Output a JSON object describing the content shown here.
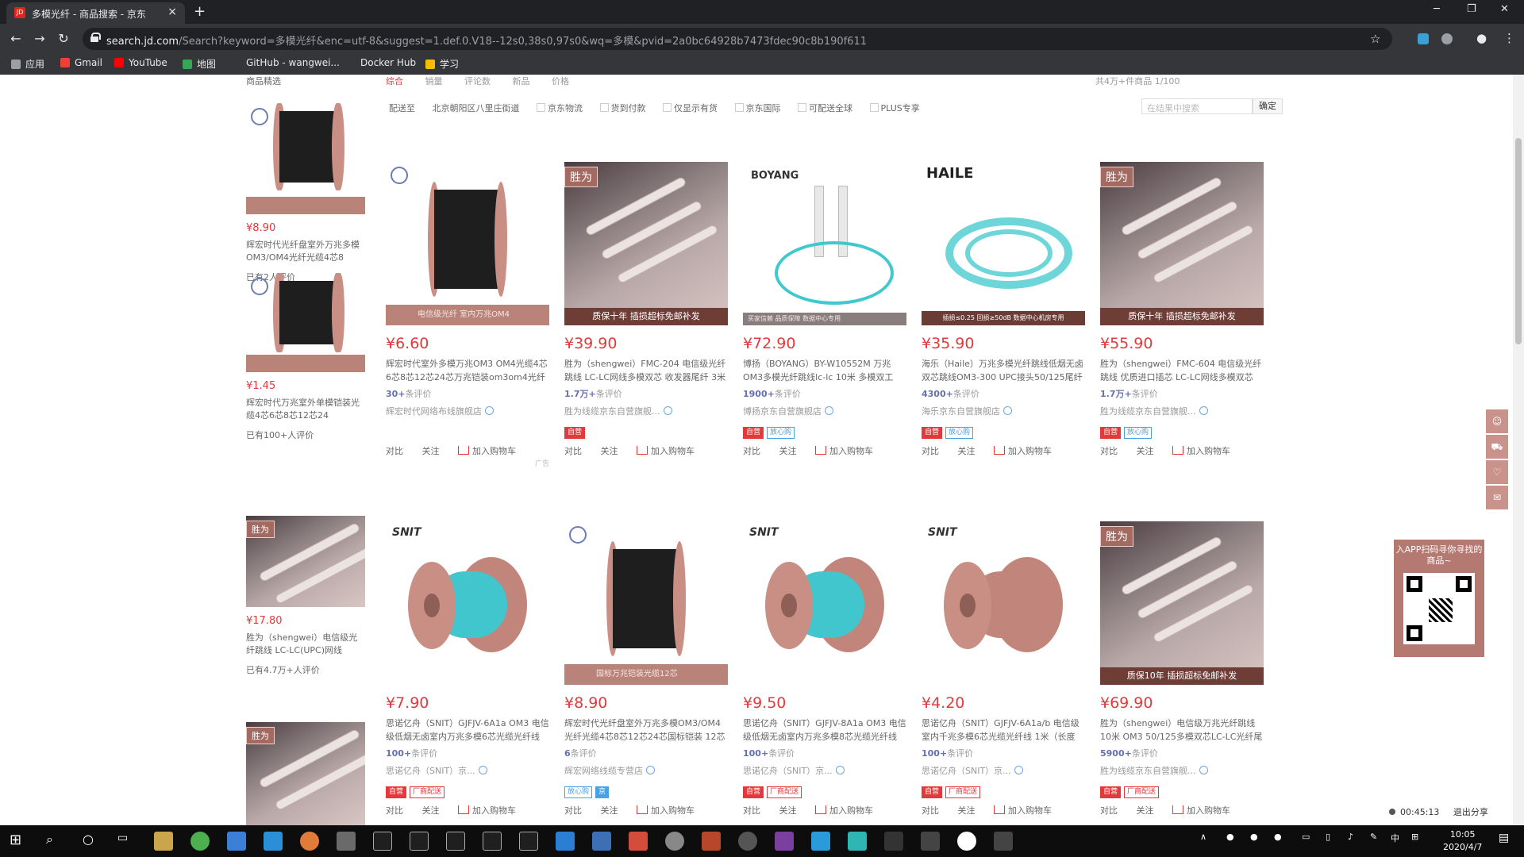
{
  "browser": {
    "tab_title": "多模光纤 - 商品搜索 - 京东",
    "tab_close": "×",
    "new_tab": "+",
    "url_host": "search.jd.com",
    "url_path": "/Search?keyword=多模光纤&enc=utf-8&suggest=1.def.0.V18--12s0,38s0,97s0&wq=多模&pvid=2a0bc64928b7473fdec90c8b190f611",
    "bookmarks": [
      "应用",
      "Gmail",
      "YouTube",
      "地图",
      "GitHub - wangwei...",
      "Docker Hub",
      "学习"
    ]
  },
  "filters": {
    "sort": [
      "综合",
      "销量",
      "评论数",
      "新品",
      "价格"
    ],
    "pager": "共4万+件商品  1/100",
    "ship_to_label": "配送至",
    "ship_to": "北京朝阳区八里庄街道",
    "options": [
      "京东物流",
      "货到付款",
      "仅显示有货",
      "京东国际",
      "可配送全球",
      "PLUS专享"
    ],
    "in_search_placeholder": "在结果中搜索",
    "confirm": "确定"
  },
  "sidebar": {
    "title": "商品精选",
    "items": [
      {
        "price": "¥8.90",
        "name": "辉宏时代光纤盘室外万兆多模OM3/OM4光纤光缆4芯8",
        "comments": "已有2人评价",
        "kind": "spool"
      },
      {
        "price": "¥1.45",
        "name": "辉宏时代万兆室外单模铠装光缆4芯6芯8芯12芯24",
        "comments": "已有100+人评价",
        "kind": "spool"
      },
      {
        "price": "¥17.80",
        "name": "胜为（shengwei）电信级光纤跳线 LC-LC(UPC)网线",
        "comments": "已有4.7万+人评价",
        "kind": "sw"
      },
      {
        "price": "",
        "name": "",
        "comments": "",
        "kind": "sw"
      }
    ]
  },
  "products": [
    {
      "price": "¥6.60",
      "name": "辉宏时代室外多模万兆OM3 OM4光缆4芯6芯8芯12芯24芯万兆铠装om3om4光纤线",
      "comments": "30+",
      "comments_suffix": "条评价",
      "shop": "辉宏时代网络布线旗舰店",
      "tags": [],
      "ad": "广告",
      "kind": "spool",
      "banner": "电信级光纤 室内万兆OM4"
    },
    {
      "price": "¥39.90",
      "name": "胜为（shengwei）FMC-204 电信级光纤跳线 LC-LC网线多模双芯 收发器尾纤 3米",
      "comments": "1.7万+",
      "comments_suffix": "条评价",
      "shop": "胜为线缆京东自营旗舰...",
      "tags": [
        "自营"
      ],
      "ad": "",
      "kind": "sw",
      "banner": "质保十年 插损超标免邮补发"
    },
    {
      "price": "¥72.90",
      "name": "博扬（BOYANG）BY-W10552M 万兆OM3多模光纤跳线lc-lc 10米 多模双工 OM3多模双",
      "comments": "1900+",
      "comments_suffix": "条评价",
      "shop": "博扬京东自营旗舰店",
      "tags": [
        "自营",
        "放心购"
      ],
      "ad": "",
      "kind": "boyang",
      "banner": "买家信赖 品质保障 数据中心专用"
    },
    {
      "price": "¥35.90",
      "name": "海乐（Haile）万兆多模光纤跳线低烟无卤双芯跳线OM3-300 UPC接头50/125尾纤",
      "comments": "4300+",
      "comments_suffix": "条评价",
      "shop": "海乐京东自营旗舰店",
      "tags": [
        "自营",
        "放心购"
      ],
      "ad": "",
      "kind": "haile",
      "banner": "插损≤0.25 回损≥50dB 数据中心机房专用"
    },
    {
      "price": "¥55.90",
      "name": "胜为（shengwei）FMC-604 电信级光纤跳线 优质进口插芯 LC-LC网线多模双芯",
      "comments": "1.7万+",
      "comments_suffix": "条评价",
      "shop": "胜为线缆京东自营旗舰...",
      "tags": [
        "自营",
        "放心购"
      ],
      "ad": "",
      "kind": "sw",
      "banner": "质保十年 插损超标免邮补发"
    },
    {
      "price": "¥7.90",
      "name": "思诺亿舟（SNIT）GJFJV-6A1a OM3 电信级低烟无卤室内万兆多模6芯光缆光纤线",
      "comments": "100+",
      "comments_suffix": "条评价",
      "shop": "思诺亿舟（SNIT）京...",
      "tags": [
        "自营",
        "厂商配送"
      ],
      "ad": "",
      "kind": "snit-blue",
      "banner": ""
    },
    {
      "price": "¥8.90",
      "name": "辉宏时代光纤盘室外万兆多模OM3/OM4光纤光缆4芯8芯12芯24芯国标铠装 12芯",
      "comments": "6",
      "comments_suffix": "条评价",
      "shop": "辉宏网络线缆专营店",
      "tags": [
        "放心购",
        "京"
      ],
      "ad": "",
      "kind": "spool",
      "banner": "国标万兆铠装光缆12芯"
    },
    {
      "price": "¥9.50",
      "name": "思诺亿舟（SNIT）GJFJV-8A1a OM3 电信级低烟无卤室内万兆多模8芯光缆光纤线",
      "comments": "100+",
      "comments_suffix": "条评价",
      "shop": "思诺亿舟（SNIT）京...",
      "tags": [
        "自营",
        "厂商配送"
      ],
      "ad": "",
      "kind": "snit-blue",
      "banner": ""
    },
    {
      "price": "¥4.20",
      "name": "思诺亿舟（SNIT）GJFJV-6A1a/b 电信级室内千兆多模6芯光缆光纤线 1米（长度",
      "comments": "100+",
      "comments_suffix": "条评价",
      "shop": "思诺亿舟（SNIT）京...",
      "tags": [
        "自营",
        "厂商配送"
      ],
      "ad": "",
      "kind": "snit-pink",
      "banner": ""
    },
    {
      "price": "¥69.90",
      "name": "胜为（shengwei）电信级万兆光纤跳线 10米 OM3 50/125多模双芯LC-LC光纤尾",
      "comments": "5900+",
      "comments_suffix": "条评价",
      "shop": "胜为线缆京东自营旗舰...",
      "tags": [
        "自营",
        "厂商配送"
      ],
      "ad": "",
      "kind": "sw",
      "banner": "质保10年 插损超标免邮补发"
    }
  ],
  "actions": {
    "compare": "对比",
    "follow": "关注",
    "add_cart": "加入购物车"
  },
  "qr": {
    "text": "入APP扫码寻你寻找的商品~"
  },
  "recorder": {
    "time": "00:45:13",
    "exit": "退出分享"
  },
  "clock": {
    "time": "10:05",
    "date": "2020/4/7"
  },
  "colors": {
    "accent": "#e4393c",
    "tab_bg": "#35363a"
  }
}
